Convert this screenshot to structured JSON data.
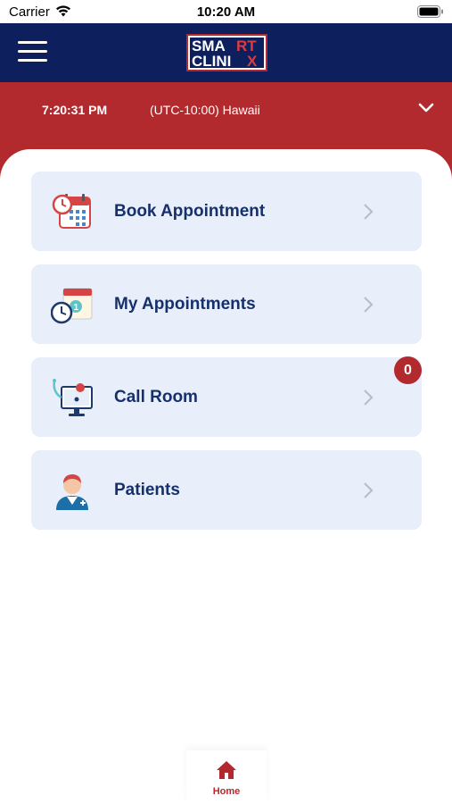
{
  "status_bar": {
    "carrier": "Carrier",
    "time": "10:20 AM",
    "icons": [
      "wifi-icon",
      "battery-icon"
    ]
  },
  "header": {
    "logo_line1_a": "SMA",
    "logo_line1_b": "RT",
    "logo_line2_a": "CLINI",
    "logo_line2_b": "X",
    "menu_icon": "hamburger-menu-icon"
  },
  "timezone": {
    "time": "7:20:31 PM",
    "zone": "(UTC-10:00) Hawaii"
  },
  "menu": {
    "items": [
      {
        "label": "Book Appointment",
        "icon": "calendar-clock-icon"
      },
      {
        "label": "My Appointments",
        "icon": "appointments-clock-icon"
      },
      {
        "label": "Call Room",
        "icon": "video-call-monitor-icon",
        "badge": "0"
      },
      {
        "label": "Patients",
        "icon": "patient-avatar-icon"
      }
    ]
  },
  "tab_bar": {
    "home_label": "Home"
  },
  "colors": {
    "header_navy": "#0e1f5e",
    "brand_red": "#b32a2e",
    "card_bg": "#e8effb",
    "label_navy": "#16306b"
  }
}
